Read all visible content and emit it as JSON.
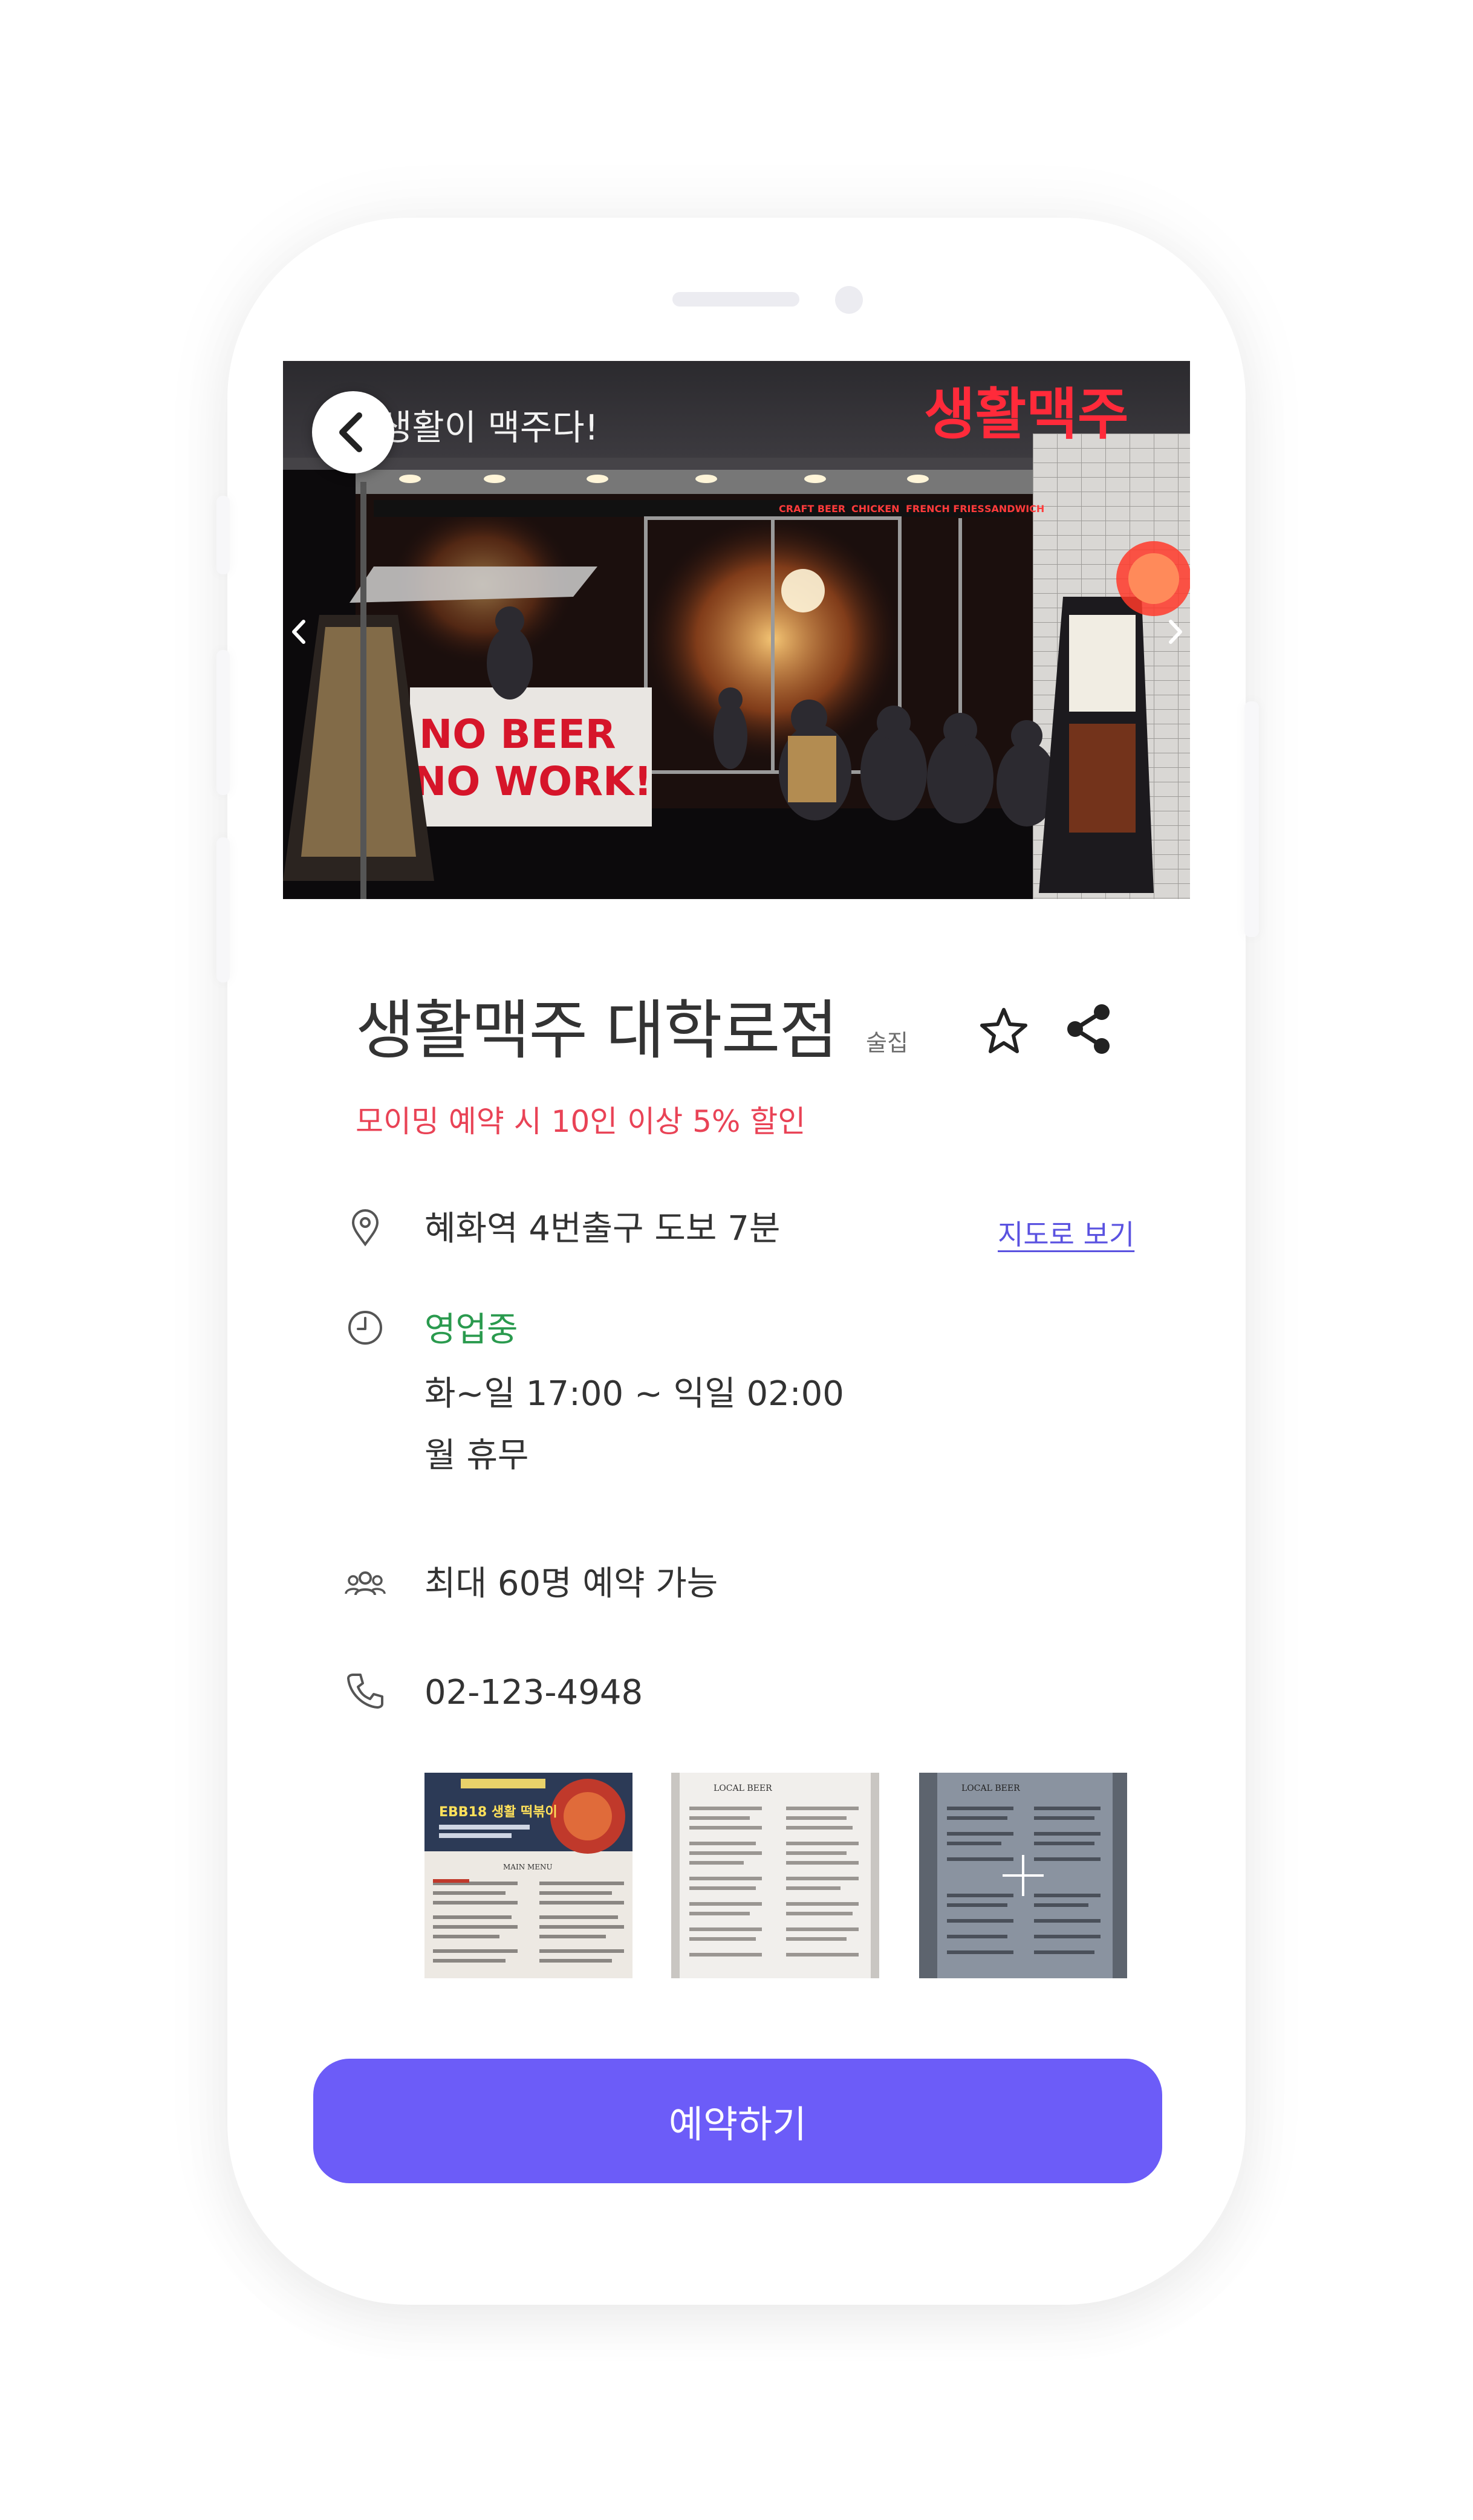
{
  "hero": {
    "sign_left": "생활이 맥주다!",
    "sign_right": "생활맥주",
    "menu_strip": [
      "CRAFT BEER",
      "CHICKEN",
      "FRENCH FRIES",
      "SANDWICH"
    ],
    "banner_text": [
      "NO BEER",
      "NO WORK!"
    ]
  },
  "store": {
    "name": "생활맥주 대학로점",
    "category": "술집",
    "promo": "모이밍 예약 시 10인 이상 5% 할인"
  },
  "location": {
    "text": "혜화역 4번출구 도보 7분",
    "map_link": "지도로 보기"
  },
  "hours": {
    "status": "영업중",
    "time": "화~일 17:00 ~ 익일 02:00",
    "closed": "월 휴무"
  },
  "capacity": "최대 60명 예약 가능",
  "phone": "02-123-4948",
  "menu_photos": {
    "first_banner": "EBB18 생활 떡볶이",
    "first_heading": "MAIN MENU",
    "second_heading": "LOCAL BEER",
    "third_heading": "LOCAL BEER"
  },
  "reserve_button": "예약하기",
  "colors": {
    "accent": "#6c5cf8",
    "promo": "#e94356",
    "open": "#2a9a4e",
    "link": "#5a52e0",
    "neon": "#ff2a3a"
  },
  "icons": [
    "chevron-left-icon",
    "chevron-right-icon",
    "star-icon",
    "share-icon",
    "location-pin-icon",
    "clock-icon",
    "people-icon",
    "phone-icon",
    "plus-icon"
  ]
}
